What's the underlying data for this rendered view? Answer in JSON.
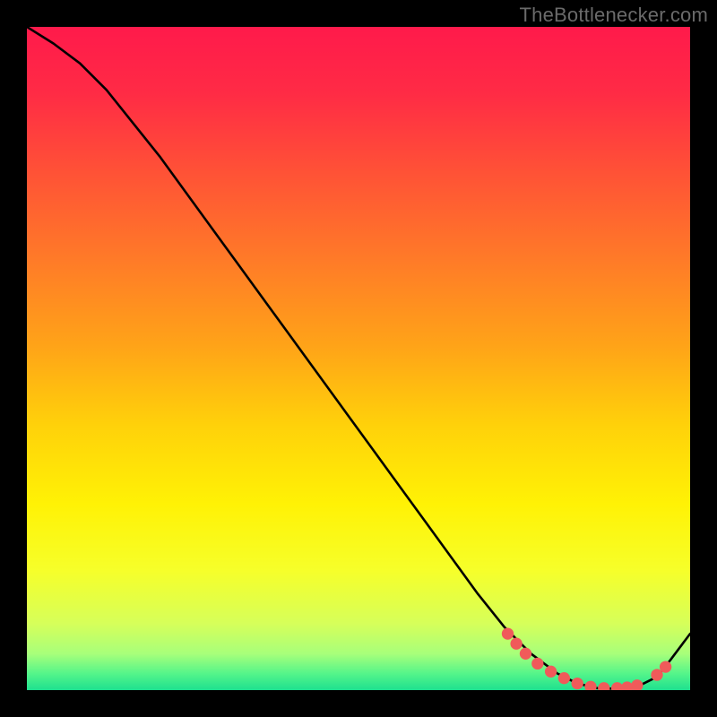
{
  "attribution": "TheBottlenecker.com",
  "gradient": {
    "stops": [
      {
        "offset": 0.0,
        "color": "#ff1a4b"
      },
      {
        "offset": 0.1,
        "color": "#ff2b45"
      },
      {
        "offset": 0.22,
        "color": "#ff5236"
      },
      {
        "offset": 0.35,
        "color": "#ff7a28"
      },
      {
        "offset": 0.48,
        "color": "#ffa318"
      },
      {
        "offset": 0.6,
        "color": "#ffd10a"
      },
      {
        "offset": 0.72,
        "color": "#fff205"
      },
      {
        "offset": 0.82,
        "color": "#f6ff2a"
      },
      {
        "offset": 0.9,
        "color": "#d6ff5a"
      },
      {
        "offset": 0.945,
        "color": "#a8ff7a"
      },
      {
        "offset": 0.975,
        "color": "#55f58a"
      },
      {
        "offset": 1.0,
        "color": "#1ee08f"
      }
    ]
  },
  "chart_data": {
    "type": "line",
    "title": "",
    "xlabel": "",
    "ylabel": "",
    "xlim": [
      0,
      100
    ],
    "ylim": [
      0,
      100
    ],
    "grid": false,
    "series": [
      {
        "name": "curve",
        "x": [
          0,
          4,
          8,
          12,
          16,
          20,
          24,
          28,
          32,
          36,
          40,
          44,
          48,
          52,
          56,
          60,
          64,
          68,
          72,
          76,
          80,
          83,
          86,
          89,
          92,
          95,
          97,
          100
        ],
        "y": [
          100,
          97.5,
          94.5,
          90.5,
          85.5,
          80.5,
          75,
          69.5,
          64,
          58.5,
          53,
          47.5,
          42,
          36.5,
          31,
          25.5,
          20,
          14.5,
          9.5,
          5.5,
          2.5,
          1.0,
          0.3,
          0.2,
          0.5,
          2.0,
          4.5,
          8.5
        ]
      }
    ],
    "markers": {
      "name": "highlight-dots",
      "color": "#f05a5a",
      "x": [
        72.5,
        73.8,
        75.2,
        77.0,
        79.0,
        81.0,
        83.0,
        85.0,
        87.0,
        89.0,
        90.5,
        92.0,
        95.0,
        96.3
      ],
      "y": [
        8.5,
        7.0,
        5.5,
        4.0,
        2.8,
        1.8,
        1.0,
        0.5,
        0.3,
        0.3,
        0.4,
        0.7,
        2.3,
        3.5
      ]
    }
  }
}
